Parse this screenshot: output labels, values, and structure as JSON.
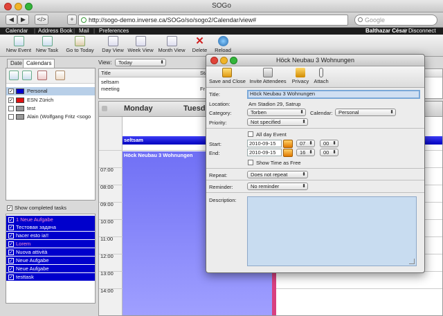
{
  "browser": {
    "window_title": "SOGo",
    "url": "http://sogo-demo.inverse.ca/SOGo/so/sogo2/Calendar/view#",
    "search_placeholder": "Google",
    "back_glyph": "◀",
    "forward_glyph": "▶",
    "source_glyph": "</>",
    "add_glyph": "+"
  },
  "appmenu": {
    "items": [
      "Calendar",
      "Address Book",
      "Mail",
      "Preferences"
    ],
    "separator": "|",
    "user": "Balthazar César",
    "disconnect": "Disconnect"
  },
  "toolbar": {
    "buttons": [
      "New Event",
      "New Task",
      "Go to Today",
      "Day View",
      "Week View",
      "Month View",
      "Delete",
      "Reload"
    ]
  },
  "leftpanel": {
    "tabs": [
      "Date",
      "Calendars"
    ],
    "calendars": [
      {
        "name": "Personal",
        "checked": "✓",
        "color": "#0000cc"
      },
      {
        "name": "ESN Zürich",
        "checked": "✓",
        "color": "#e01010"
      },
      {
        "name": "test",
        "checked": "",
        "color": "#999999"
      },
      {
        "name": "Alain (Wolfgang Fritz <sogo",
        "checked": "",
        "color": "#999999"
      }
    ],
    "show_completed": "Show completed tasks",
    "show_completed_check": "✓",
    "tasks": [
      "1 Neue Aufgabe",
      "Тестовая задача",
      "hacer esto ia!!",
      "Lorem",
      "Nuova attività",
      "Neue Aufgabe",
      "Neue Aufgabe",
      "testtask"
    ],
    "task_check": "✓"
  },
  "calendar": {
    "view_label": "View:",
    "view_value": "Today",
    "list_headers": [
      "Title",
      "Sta"
    ],
    "list_rows": [
      "seltsam",
      "meeting"
    ],
    "list_rows_col2": [
      "",
      "Fr"
    ],
    "days": [
      "Monday",
      "Tuesd"
    ],
    "hours": [
      "07:00",
      "08:00",
      "09:00",
      "10:00",
      "11:00",
      "12:00",
      "13:00",
      "14:00"
    ],
    "allday_event": "seltsam",
    "event": "Höck Neubau 3 Wohnungen"
  },
  "dialog": {
    "title": "Höck Neubau 3 Wohnungen",
    "buttons": [
      "Save and Close",
      "Invite Attendees",
      "Privacy",
      "Attach"
    ],
    "title_label": "Title:",
    "title_value": "Höck Neubau 3 Wohnungen",
    "location_label": "Location:",
    "location_value": "Am Stadion 29, Satrup",
    "category_label": "Category:",
    "category_value": "Torben",
    "calendar_label": "Calendar:",
    "calendar_value": "Personal",
    "priority_label": "Priority:",
    "priority_value": "Not specified",
    "allday_label": "All day Event",
    "start_label": "Start:",
    "start_date": "2010-09-15",
    "start_hour": "07",
    "start_min": "00",
    "end_label": "End:",
    "end_date": "2010-09-15",
    "end_hour": "16",
    "end_min": "00",
    "showfree_label": "Show Time as Free",
    "repeat_label": "Repeat:",
    "repeat_value": "Does not repeat",
    "reminder_label": "Reminder:",
    "reminder_value": "No reminder",
    "description_label": "Description:",
    "select_arrow": "⬍"
  },
  "colors": {
    "accent_blue": "#0000cc",
    "dialog_field_focus": "#d0dff2",
    "close_red": "#e0443a",
    "minimize_yellow": "#f0b428",
    "zoom_green": "#34b53a"
  }
}
